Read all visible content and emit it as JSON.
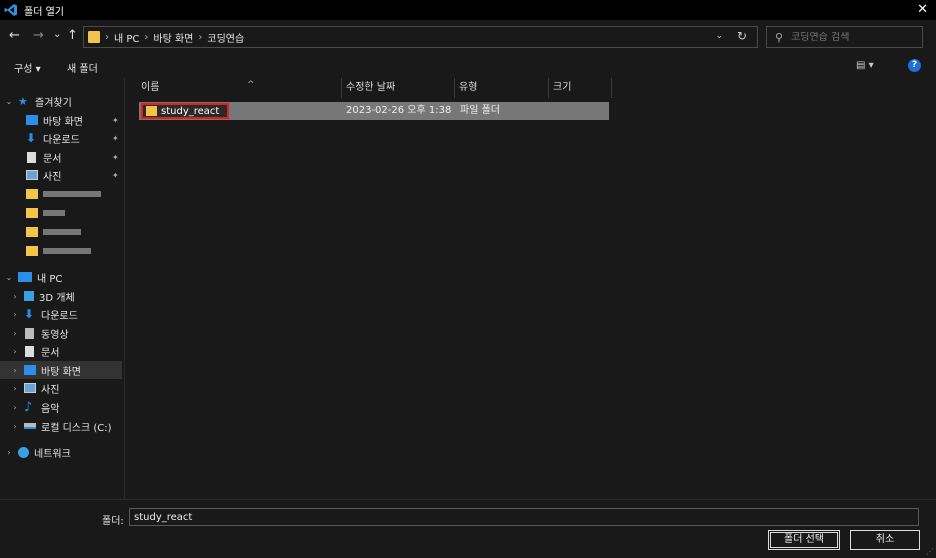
{
  "window": {
    "title": "폴더 열기",
    "close_glyph": "✕",
    "icon": "vscode-icon"
  },
  "nav": {
    "back": "←",
    "forward": "→",
    "recent": "⌄",
    "up": "↑",
    "breadcrumbs": [
      "내 PC",
      "바탕 화면",
      "코딩연습"
    ],
    "separator": "›",
    "refresh": "↻",
    "dropdown": "⌄",
    "search_placeholder": "코딩연습 검색"
  },
  "toolbar": {
    "organize": "구성 ▾",
    "new_folder": "새 폴더",
    "view": "▤ ▾",
    "help": "?"
  },
  "sidebar": {
    "quick_access": "즐겨찾기",
    "quick_items": [
      {
        "label": "바탕 화면",
        "icon": "desktop-icon",
        "color": "#2b8ee8"
      },
      {
        "label": "다운로드",
        "icon": "download-icon",
        "color": "#2b8ee8"
      },
      {
        "label": "문서",
        "icon": "document-icon",
        "color": "#dcdcdc"
      },
      {
        "label": "사진",
        "icon": "pictures-icon",
        "color": "#6aa3d9"
      }
    ],
    "pin": "📌",
    "this_pc": "내 PC",
    "pc_items": [
      {
        "label": "3D 개체",
        "icon": "3d-objects-icon",
        "color": "#3aa0e0"
      },
      {
        "label": "다운로드",
        "icon": "download-icon",
        "color": "#2b8ee8"
      },
      {
        "label": "동영상",
        "icon": "videos-icon",
        "color": "#cccccc"
      },
      {
        "label": "문서",
        "icon": "document-icon",
        "color": "#dcdcdc"
      },
      {
        "label": "바탕 화면",
        "icon": "desktop-icon",
        "color": "#2b8ee8"
      },
      {
        "label": "사진",
        "icon": "pictures-icon",
        "color": "#6aa3d9"
      },
      {
        "label": "음악",
        "icon": "music-icon",
        "color": "#2b8ee8"
      },
      {
        "label": "로컬 디스크 (C:)",
        "icon": "drive-icon",
        "color": "#bbbbbb"
      }
    ],
    "network": "네트워크",
    "selected": "바탕 화면"
  },
  "columns": {
    "name": "이름",
    "modified": "수정한 날짜",
    "type": "유형",
    "size": "크기",
    "sort_arrow": "^"
  },
  "files": [
    {
      "name": "study_react",
      "modified": "2023-02-26 오후 1:38",
      "type": "파일 폴더",
      "size": ""
    }
  ],
  "footer": {
    "folder_label": "폴더:",
    "folder_value": "study_react",
    "select_button": "폴더 선택",
    "cancel_button": "취소"
  },
  "colors": {
    "folder": "#f3c44a",
    "highlight": "#e02020",
    "accent": "#1e6fd9"
  }
}
